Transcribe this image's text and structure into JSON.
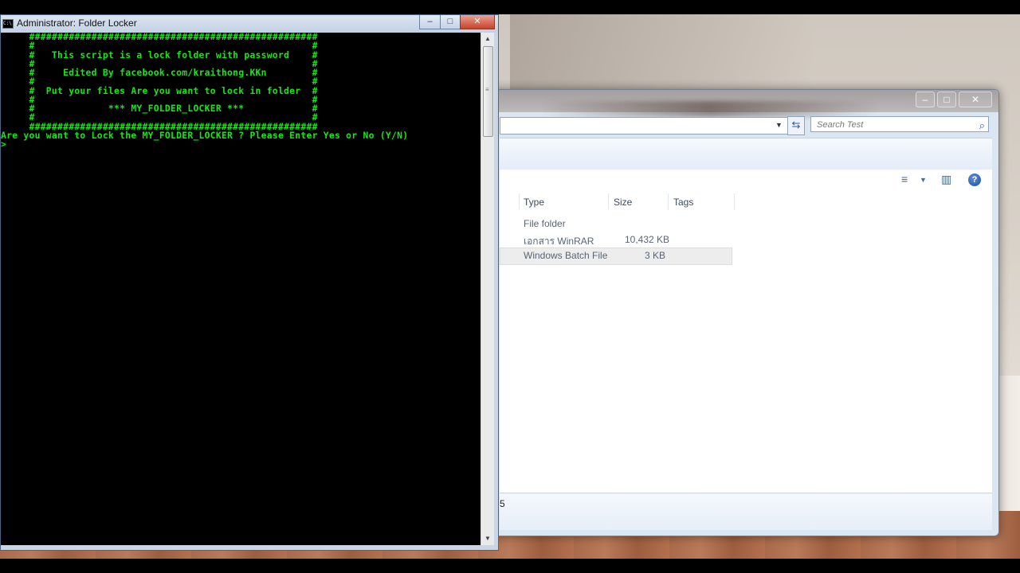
{
  "console": {
    "title": "Administrator:  Folder Locker",
    "icon": "cmd-icon",
    "icon_text": "C:\\",
    "minimize_glyph": "–",
    "maximize_glyph": "□",
    "close_glyph": "✕",
    "lines": [
      "     ###################################################",
      "     #                                                 #",
      "     #   This script is a lock folder with password    #",
      "     #                                                 #",
      "     #     Edited By facebook.com/kraithong.KKn        #",
      "     #                                                 #",
      "     #  Put your files Are you want to lock in folder  #",
      "     #                                                 #",
      "     #             *** MY_FOLDER_LOCKER ***            #",
      "     #                                                 #",
      "     ###################################################",
      "Are you want to Lock the MY_FOLDER_LOCKER ? Please Enter Yes or No (Y/N)",
      ">"
    ],
    "text_color": "#19e619",
    "scrollbar": {
      "up": "▲",
      "down": "▼",
      "grip": "≡"
    }
  },
  "explorer": {
    "caption": {
      "minimize": "–",
      "maximize": "□",
      "close": "✕"
    },
    "address_dropdown": "▼",
    "refresh_glyph": "⇆",
    "search": {
      "placeholder": "Search Test",
      "icon": "search-icon",
      "glyph": "⌕"
    },
    "toolbar": {
      "views_glyph": "≡",
      "views_dropdown": "▼",
      "preview_glyph": "▥",
      "help_glyph": "?"
    },
    "columns": [
      "Type",
      "Size",
      "Tags"
    ],
    "rows": [
      {
        "type": "File folder",
        "size": ""
      },
      {
        "type": "เอกสาร WinRAR",
        "size": "10,432 KB"
      },
      {
        "type": "Windows Batch File",
        "size": "3 KB"
      }
    ],
    "status_text": "5"
  }
}
